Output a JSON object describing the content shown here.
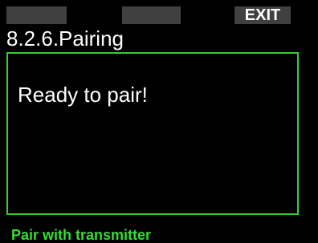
{
  "softkeys": {
    "left_label": "",
    "middle_label": "",
    "right_label": "EXIT"
  },
  "header": {
    "title": "8.2.6.Pairing"
  },
  "panel": {
    "message": "Ready to pair!"
  },
  "footer": {
    "status": "Pair with transmitter"
  },
  "colors": {
    "background": "#000000",
    "softkey_bg": "#404040",
    "accent_green": "#2fd12f",
    "text_white": "#ffffff",
    "status_green": "#33dd33"
  }
}
